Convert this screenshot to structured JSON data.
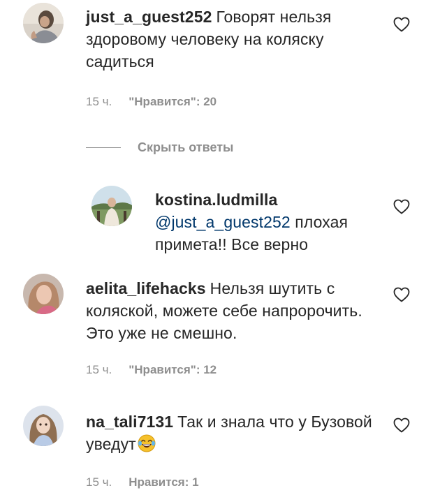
{
  "comments": [
    {
      "username": "just_a_guest252",
      "text": "Говорят нельзя здоровому человеку на коляску садиться",
      "time": "15 ч.",
      "likes": "\"Нравится\": 20"
    },
    {
      "username": "aelita_lifehacks",
      "text": "Нельзя шутить с коляской, можете себе напророчить. Это уже не смешно.",
      "time": "15 ч.",
      "likes": "\"Нравится\": 12"
    },
    {
      "username": "na_tali7131",
      "text": "Так и знала что у Бузовой уведут",
      "emoji": "laughing-crying-emoji",
      "time": "15 ч.",
      "likes": "Нравится: 1"
    }
  ],
  "reply_toggle": {
    "label": "Скрыть ответы"
  },
  "reply": {
    "username": "kostina.ludmilla",
    "mention": "@just_a_guest252",
    "text": "плохая примета!! Все верно"
  },
  "icons": {
    "like": "heart-outline-icon"
  },
  "colors": {
    "text": "#262626",
    "meta": "#8e8e8e",
    "mention": "#00376b"
  }
}
